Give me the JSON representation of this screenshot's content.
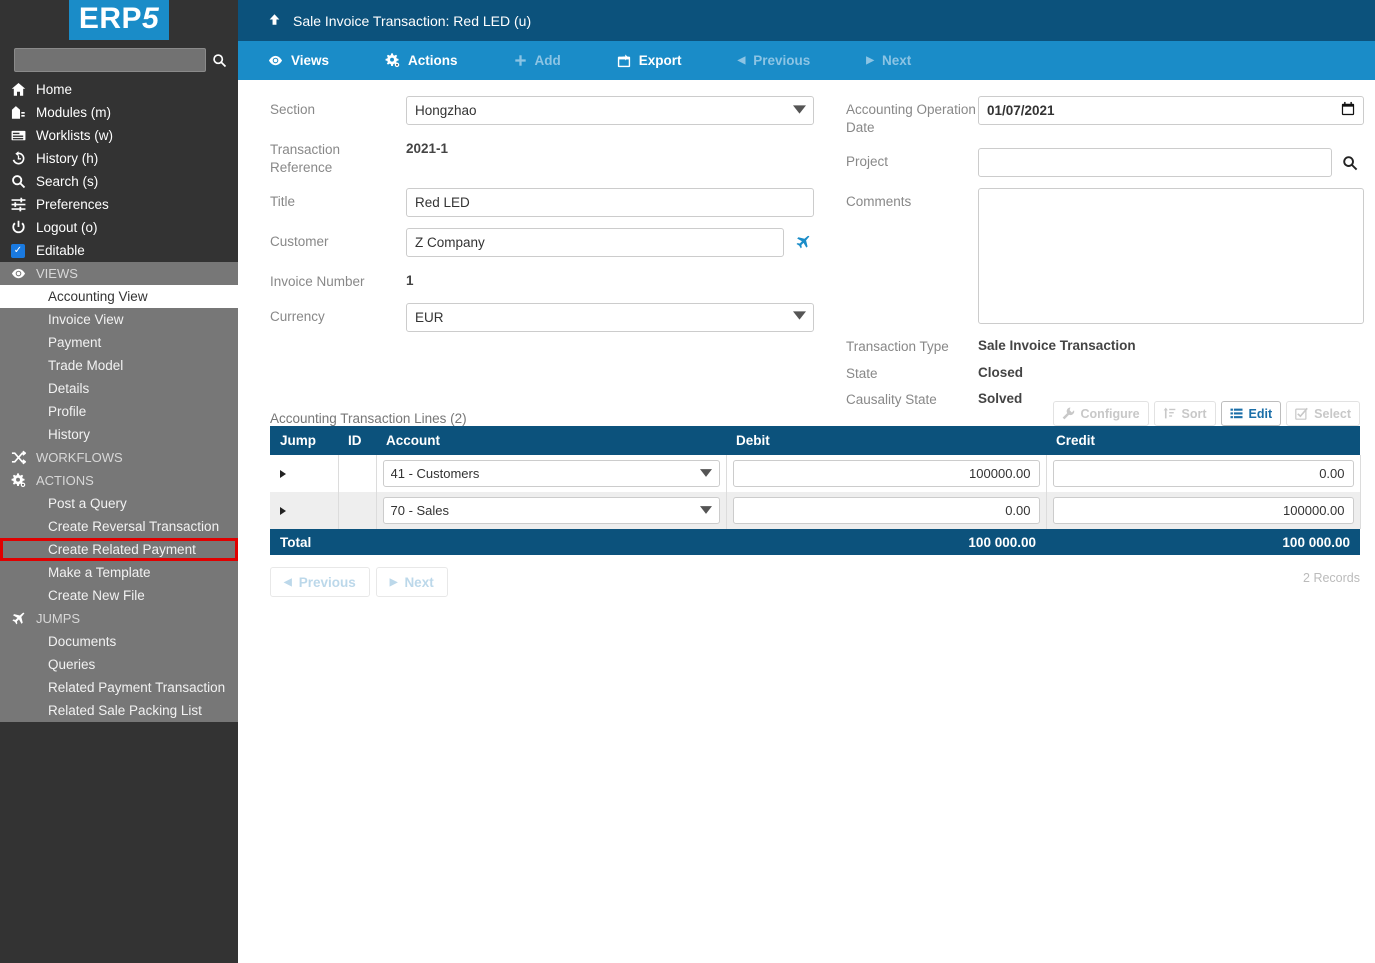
{
  "brand": {
    "name": "ERP5",
    "accent": "#1a8cc8"
  },
  "sidebar": {
    "search_placeholder": "",
    "search_value": "",
    "nav": [
      {
        "label": "Home",
        "icon": "home-icon"
      },
      {
        "label": "Modules (m)",
        "icon": "modules-icon"
      },
      {
        "label": "Worklists (w)",
        "icon": "worklists-icon"
      },
      {
        "label": "History (h)",
        "icon": "history-icon"
      },
      {
        "label": "Search (s)",
        "icon": "search-icon"
      },
      {
        "label": "Preferences",
        "icon": "sliders-icon"
      },
      {
        "label": "Logout (o)",
        "icon": "power-icon"
      },
      {
        "label": "Editable",
        "icon": "checkbox-icon"
      }
    ],
    "groups": [
      {
        "title": "VIEWS",
        "icon": "eye-icon",
        "items": [
          {
            "label": "Accounting View",
            "selected": true
          },
          {
            "label": "Invoice View"
          },
          {
            "label": "Payment"
          },
          {
            "label": "Trade Model"
          },
          {
            "label": "Details"
          },
          {
            "label": "Profile"
          },
          {
            "label": "History"
          }
        ]
      },
      {
        "title": "WORKFLOWS",
        "icon": "workflows-icon",
        "items": []
      },
      {
        "title": "ACTIONS",
        "icon": "actions-icon",
        "items": [
          {
            "label": "Post a Query"
          },
          {
            "label": "Create Reversal Transaction"
          },
          {
            "label": "Create Related Payment",
            "highlighted": true
          },
          {
            "label": "Make a Template"
          },
          {
            "label": "Create New File"
          }
        ]
      },
      {
        "title": "JUMPS",
        "icon": "plane-icon",
        "items": [
          {
            "label": "Documents"
          },
          {
            "label": "Queries"
          },
          {
            "label": "Related Payment Transaction"
          },
          {
            "label": "Related Sale Packing List"
          }
        ]
      }
    ],
    "highlight_color": "#e00000"
  },
  "header": {
    "up_icon": "arrow-up-icon",
    "title": "Sale Invoice Transaction: Red LED (u)"
  },
  "toolbar": [
    {
      "label": "Views",
      "icon": "eye-icon",
      "disabled": false
    },
    {
      "label": "Actions",
      "icon": "actions-icon",
      "disabled": false
    },
    {
      "label": "Add",
      "icon": "plus-icon",
      "disabled": true
    },
    {
      "label": "Export",
      "icon": "export-icon",
      "disabled": false
    },
    {
      "label": "Previous",
      "icon": "prev-icon",
      "disabled": true
    },
    {
      "label": "Next",
      "icon": "next-icon",
      "disabled": true
    }
  ],
  "form": {
    "left": {
      "section_label": "Section",
      "section_value": "Hongzhao",
      "transaction_reference_label": "Transaction Reference",
      "transaction_reference_value": "2021-1",
      "title_label": "Title",
      "title_value": "Red LED",
      "customer_label": "Customer",
      "customer_value": "Z Company",
      "customer_jump_icon": "plane-icon",
      "invoice_number_label": "Invoice Number",
      "invoice_number_value": "1",
      "currency_label": "Currency",
      "currency_value": "EUR"
    },
    "right": {
      "date_label": "Accounting Operation Date",
      "date_value": "01/07/2021",
      "date_icon": "calendar-icon",
      "project_label": "Project",
      "project_value": "",
      "project_search_icon": "search-icon",
      "comments_label": "Comments",
      "comments_value": "",
      "transaction_type_label": "Transaction Type",
      "transaction_type_value": "Sale Invoice Transaction",
      "state_label": "State",
      "state_value": "Closed",
      "causality_state_label": "Causality State",
      "causality_state_value": "Solved"
    }
  },
  "list": {
    "title": "Accounting Transaction Lines (2)",
    "buttons": [
      {
        "label": "Configure",
        "icon": "wrench-icon",
        "active": false
      },
      {
        "label": "Sort",
        "icon": "sort-icon",
        "active": false
      },
      {
        "label": "Edit",
        "icon": "list-icon",
        "active": true
      },
      {
        "label": "Select",
        "icon": "checkbox-outline-icon",
        "active": false
      }
    ],
    "columns": [
      "Jump",
      "ID",
      "Account",
      "Debit",
      "Credit"
    ],
    "rows": [
      {
        "jump": "jump-icon",
        "id": "",
        "account": "41 - Customers",
        "debit": "100000.00",
        "credit": "0.00"
      },
      {
        "jump": "jump-icon",
        "id": "",
        "account": "70 - Sales",
        "debit": "0.00",
        "credit": "100000.00"
      }
    ],
    "total": {
      "label": "Total",
      "debit": "100 000.00",
      "credit": "100 000.00"
    },
    "pager": [
      {
        "label": "Previous",
        "icon": "prev-icon"
      },
      {
        "label": "Next",
        "icon": "next-icon"
      }
    ],
    "record_count": "2 Records"
  }
}
